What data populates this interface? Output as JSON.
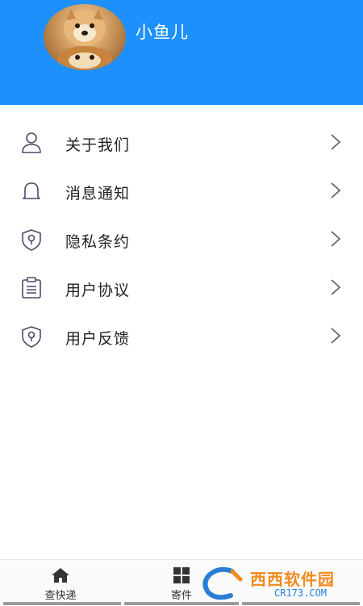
{
  "profile": {
    "username": "小鱼儿"
  },
  "menu": {
    "items": [
      {
        "label": "关于我们",
        "icon": "user-icon"
      },
      {
        "label": "消息通知",
        "icon": "bell-icon"
      },
      {
        "label": "隐私条约",
        "icon": "shield-icon"
      },
      {
        "label": "用户协议",
        "icon": "clipboard-icon"
      },
      {
        "label": "用户反馈",
        "icon": "shield-icon"
      }
    ]
  },
  "bottom_nav": {
    "tabs": [
      {
        "label": "查快递",
        "icon": "home-icon"
      },
      {
        "label": "寄件",
        "icon": "grid-icon"
      }
    ]
  },
  "watermark": {
    "text": "西西软件园",
    "sub": "CR173.COM"
  },
  "colors": {
    "header": "#1e90fb",
    "icon_stroke": "#4a4a6a"
  }
}
